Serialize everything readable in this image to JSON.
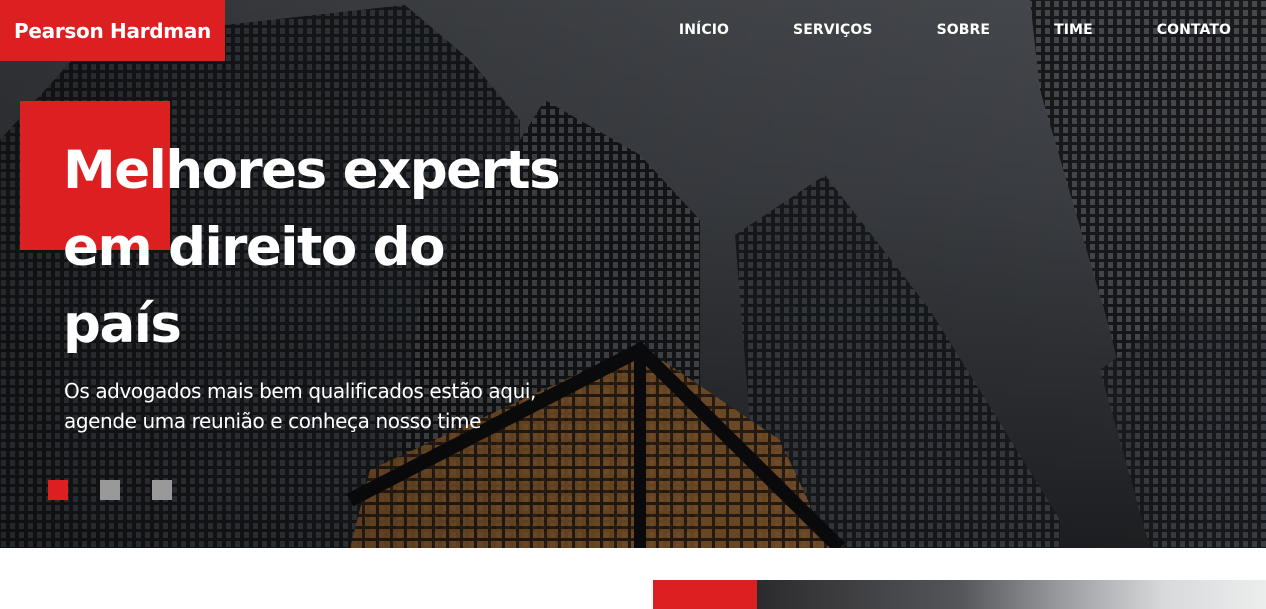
{
  "header": {
    "logo_text": "Pearson Hardman",
    "nav": [
      {
        "label": "INÍCIO"
      },
      {
        "label": "SERVIÇOS"
      },
      {
        "label": "SOBRE"
      },
      {
        "label": "TIME"
      },
      {
        "label": "CONTATO"
      }
    ]
  },
  "hero": {
    "headline_line1": "Melhores experts",
    "headline_line2": "em direito do",
    "headline_line3": "país",
    "subtitle_line1": "Os advogados mais bem qualificados estão aqui,",
    "subtitle_line2": "agende uma reunião e conheça nosso time",
    "background_image": "city-skyscrapers-photo",
    "slides": {
      "count": 3,
      "active": 1
    }
  },
  "colors": {
    "accent": "#dc2022",
    "dot_inactive": "#999999",
    "text": "#ffffff"
  }
}
